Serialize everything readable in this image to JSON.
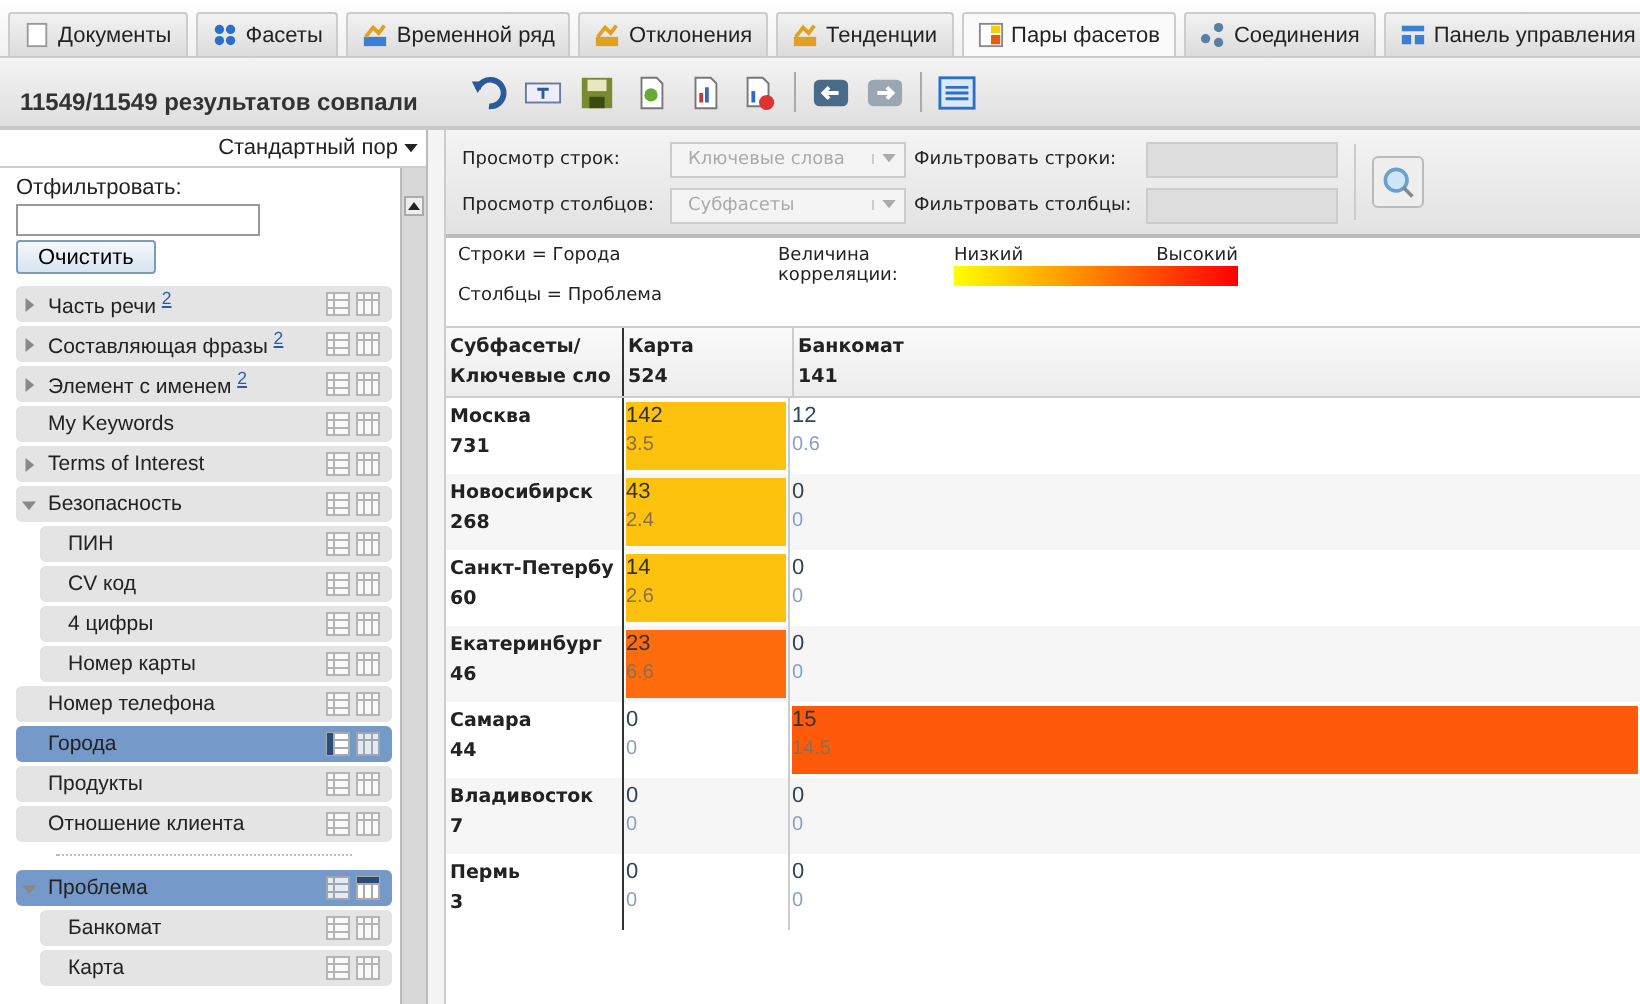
{
  "tabs": [
    {
      "label": "Документы",
      "kind": "doc",
      "selected": false
    },
    {
      "label": "Фасеты",
      "kind": "facets",
      "selected": false
    },
    {
      "label": "Временной ряд",
      "kind": "time",
      "selected": false
    },
    {
      "label": "Отклонения",
      "kind": "dev",
      "selected": false
    },
    {
      "label": "Тенденции",
      "kind": "trend",
      "selected": false
    },
    {
      "label": "Пары фасетов",
      "kind": "pairs",
      "selected": true
    },
    {
      "label": "Соединения",
      "kind": "conn",
      "selected": false
    },
    {
      "label": "Панель управления",
      "kind": "dash",
      "selected": false
    }
  ],
  "toolbar": {
    "result_count": "11549/11549 результатов совпали"
  },
  "sidebar": {
    "sort": "Стандартный пор",
    "filter_label": "Отфильтровать:",
    "clear_button": "Очистить",
    "groups": [
      {
        "items": [
          {
            "label": "Часть речи $^{2}$",
            "expanded": false,
            "as_rows": false,
            "as_columns": false,
            "selected": false
          },
          {
            "label": "Составляющая фразы $^{2}$",
            "expanded": false,
            "as_rows": false,
            "as_columns": false,
            "selected": false
          },
          {
            "label": "Элемент с именем $^{2}$",
            "expanded": false,
            "as_rows": false,
            "as_columns": false,
            "selected": false
          },
          {
            "label": "My Keywords",
            "as_rows": false,
            "as_columns": false,
            "selected": false
          },
          {
            "label": "Terms of Interest",
            "expanded": false,
            "as_rows": false,
            "as_columns": false,
            "selected": false
          },
          {
            "label": "Безопасность",
            "expanded": true,
            "as_rows": false,
            "as_columns": false,
            "selected": false,
            "children": [
              {
                "label": "ПИН",
                "as_rows": false,
                "as_columns": false,
                "selected": false
              },
              {
                "label": "CV код",
                "as_rows": false,
                "as_columns": false,
                "selected": false
              },
              {
                "label": "4 цифры",
                "as_rows": false,
                "as_columns": false,
                "selected": false
              },
              {
                "label": "Номер карты",
                "as_rows": false,
                "as_columns": false,
                "selected": false
              }
            ]
          },
          {
            "label": "Номер телефона",
            "as_rows": false,
            "as_columns": false,
            "selected": false
          },
          {
            "label": "Города",
            "as_rows": true,
            "as_columns": false,
            "selected": true
          },
          {
            "label": "Продукты",
            "as_rows": false,
            "as_columns": false,
            "selected": false
          },
          {
            "label": "Отношение клиента",
            "as_rows": false,
            "as_columns": false,
            "selected": false
          }
        ]
      },
      {
        "items": [
          {
            "label": "Проблема",
            "expanded": true,
            "as_rows": false,
            "as_columns": true,
            "selected": true,
            "children": [
              {
                "label": "Банкомат",
                "as_rows": false,
                "as_columns": false,
                "selected": false
              },
              {
                "label": "Карта",
                "as_rows": false,
                "as_columns": false,
                "selected": false
              }
            ]
          }
        ]
      }
    ]
  },
  "controls": {
    "row_view_label": "Просмотр строк:",
    "row_view": "Ключевые слова",
    "column_view_label": "Просмотр столбцов:",
    "column_view": "Субфасеты",
    "filter_rows_label": "Фильтровать строки:",
    "filter_columns_label": "Фильтровать столбцы:"
  },
  "legend": {
    "rows": "Строки = Города",
    "columns": "Столбцы = Проблема",
    "title": "Величина корреляции:",
    "low": "Низкий",
    "high": "Высокий"
  },
  "matrix": {
    "corner": [
      "Субфасеты/",
      "Ключевые сло"
    ],
    "columns": [
      {
        "name": "Карта",
        "count": "524"
      },
      {
        "name": "Банкомат",
        "count": "141"
      }
    ],
    "rows": [
      {
        "name": "Москва",
        "count": "731",
        "cells": [
          {
            "count": "142",
            "value": "3.5",
            "color": "#fdc20e"
          },
          {
            "count": "12",
            "value": "0.6"
          }
        ]
      },
      {
        "name": "Новосибирск",
        "count": "268",
        "cells": [
          {
            "count": "43",
            "value": "2.4",
            "color": "#fdc20e"
          },
          {
            "count": "0",
            "value": "0"
          }
        ]
      },
      {
        "name": "Санкт-Петербу",
        "count": "60",
        "cells": [
          {
            "count": "14",
            "value": "2.6",
            "color": "#fdc20e"
          },
          {
            "count": "0",
            "value": "0"
          }
        ]
      },
      {
        "name": "Екатеринбург",
        "count": "46",
        "cells": [
          {
            "count": "23",
            "value": "6.6",
            "color": "#ff6c0e"
          },
          {
            "count": "0",
            "value": "0"
          }
        ]
      },
      {
        "name": "Самара",
        "count": "44",
        "cells": [
          {
            "count": "0",
            "value": "0"
          },
          {
            "count": "15",
            "value": "14.5",
            "color": "#ff5a0a"
          }
        ]
      },
      {
        "name": "Владивосток",
        "count": "7",
        "cells": [
          {
            "count": "0",
            "value": "0"
          },
          {
            "count": "0",
            "value": "0"
          }
        ]
      },
      {
        "name": "Пермь",
        "count": "3",
        "cells": [
          {
            "count": "0",
            "value": "0"
          },
          {
            "count": "0",
            "value": "0"
          }
        ]
      }
    ]
  }
}
